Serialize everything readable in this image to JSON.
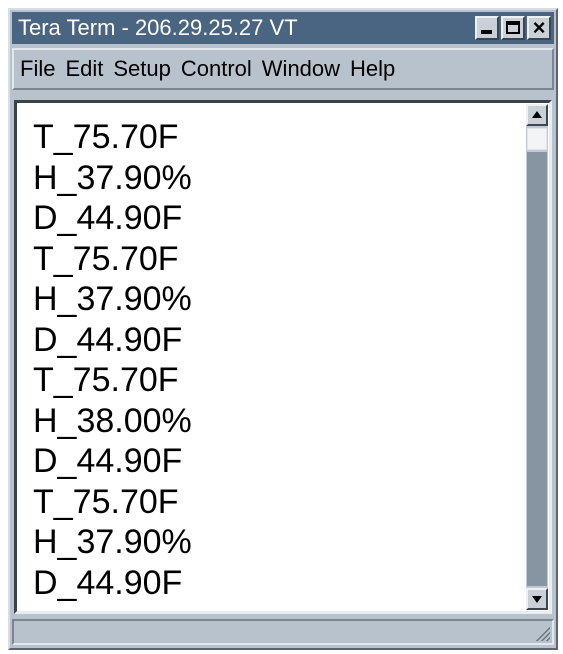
{
  "window": {
    "title": "Tera Term - 206.29.25.27 VT"
  },
  "menu": {
    "items": [
      "File",
      "Edit",
      "Setup",
      "Control",
      "Window",
      "Help"
    ]
  },
  "terminal": {
    "lines": [
      "T_75.70F",
      "H_37.90%",
      "D_44.90F",
      "T_75.70F",
      "H_37.90%",
      "D_44.90F",
      "T_75.70F",
      "H_38.00%",
      "D_44.90F",
      "T_75.70F",
      "H_37.90%",
      "D_44.90F"
    ]
  },
  "icons": {
    "minimize": "minimize-icon",
    "maximize": "maximize-icon",
    "close": "close-icon",
    "scroll_up": "arrow-up-icon",
    "scroll_down": "arrow-down-icon",
    "resize": "resize-grip-icon"
  },
  "colors": {
    "titlebar": "#4a6582",
    "chrome": "#b8c2cc",
    "scroll_track": "#8795a3",
    "terminal_bg": "#ffffff",
    "terminal_text": "#000000"
  }
}
